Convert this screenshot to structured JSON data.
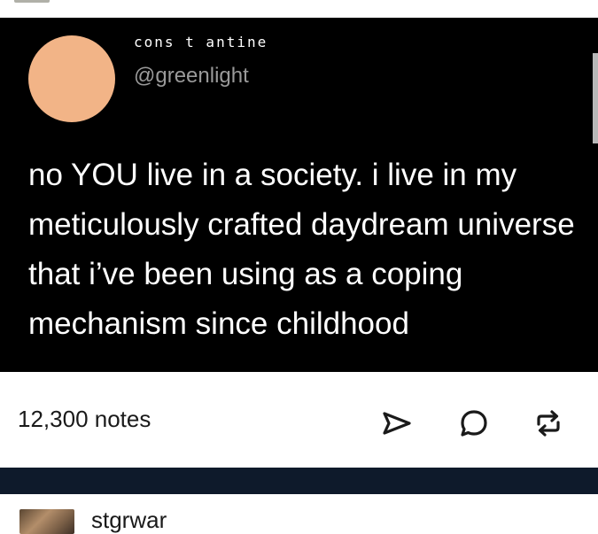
{
  "tweet": {
    "display_name": "cons t antine",
    "handle": "@greenlight",
    "text": "no YOU live in a society. i live in my meticulously crafted daydream universe that i’ve been using as a coping mechanism since childhood"
  },
  "footer": {
    "notes": "12,300 notes",
    "icons": [
      "send-icon",
      "reply-icon",
      "reblog-icon"
    ]
  },
  "next_post": {
    "username": "stgrwar"
  },
  "colors": {
    "tweet_bg": "#000000",
    "avatar": "#f2b487",
    "navy_bar": "#0e1a2b"
  }
}
